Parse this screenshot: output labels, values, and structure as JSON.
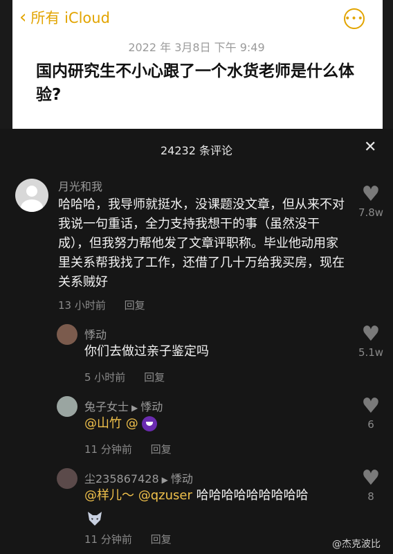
{
  "header": {
    "back_label": "所有 iCloud",
    "date": "2022 年 3月8日 下午 9:49",
    "title": "国内研究生不小心跟了一个水货老师是什么体验?"
  },
  "comments_panel": {
    "count_label": "24232 条评论",
    "close_icon": "close-icon"
  },
  "comments": [
    {
      "author": "月光和我",
      "text": "哈哈哈，我导师就挺水，没课题没文章，但从来不对我说一句重话，全力支持我想干的事（虽然没干成），但我努力帮他发了文章评职称。毕业他动用家里关系帮我找了工作，还借了几十万给我买房，现在关系贼好",
      "time": "13 小时前",
      "reply": "回复",
      "likes": "7.8w"
    }
  ],
  "replies": [
    {
      "author": "悸动",
      "text": "你们去做过亲子鉴定吗",
      "time": "5 小时前",
      "reply": "回复",
      "likes": "5.1w"
    },
    {
      "author": "兔子女士",
      "target": "悸动",
      "mention": "@山竹",
      "mention2": "@",
      "time": "11 分钟前",
      "reply": "回复",
      "likes": "6"
    },
    {
      "author": "尘235867428",
      "target": "悸动",
      "mention": "@样儿～",
      "mention2": "@qzuser",
      "text": "哈哈哈哈哈哈哈哈哈",
      "time": "11 分钟前",
      "reply": "回复",
      "likes": "8"
    }
  ],
  "watermark": "@杰克波比"
}
